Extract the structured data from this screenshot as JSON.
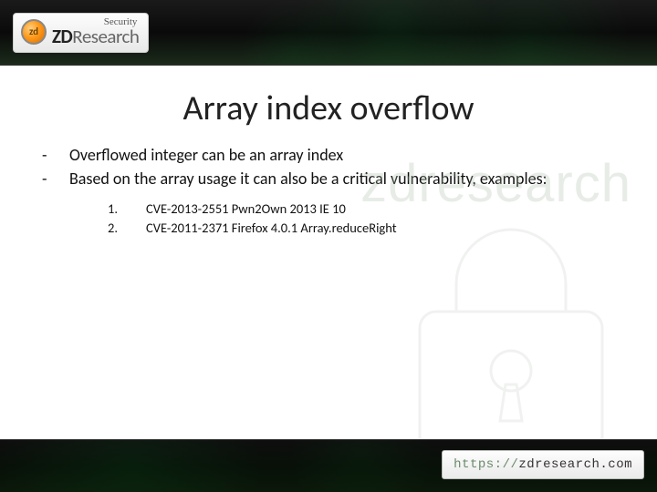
{
  "header": {
    "logo_security": "Security",
    "logo_zd": "ZD",
    "logo_rest": "Research"
  },
  "slide": {
    "title": "Array index overflow",
    "watermark": "zdresearch",
    "bullets": [
      "Overflowed integer can be an array index",
      "Based on the array usage it can also be a critical vulnerability, examples:"
    ],
    "examples": [
      {
        "n": "1.",
        "text": "CVE-2013-2551 Pwn2Own 2013 IE 10"
      },
      {
        "n": "2.",
        "text": "CVE-2011-2371 Firefox 4.0.1 Array.reduceRight"
      }
    ]
  },
  "footer": {
    "url_proto": "https://",
    "url_host": "zdresearch.com"
  }
}
